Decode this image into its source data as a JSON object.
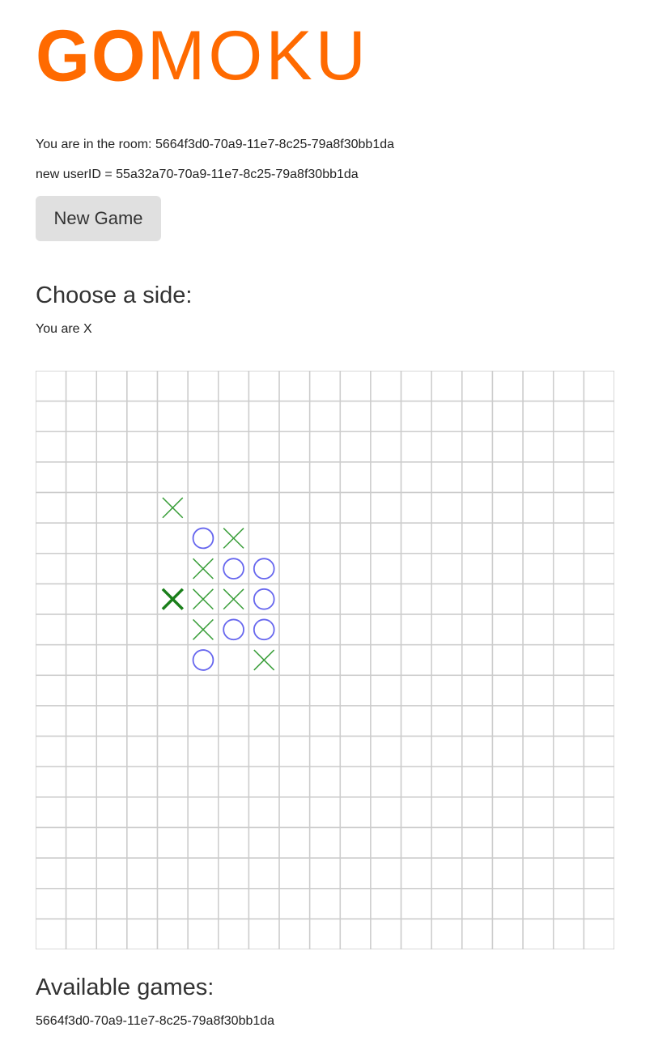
{
  "app": {
    "logo_bold": "GO",
    "logo_thin": "MOKU"
  },
  "room": {
    "label": "You are in the room: 5664f3d0-70a9-11e7-8c25-79a8f30bb1da"
  },
  "user": {
    "label": "new userID = 55a32a70-70a9-11e7-8c25-79a8f30bb1da"
  },
  "controls": {
    "new_game_label": "New Game"
  },
  "side": {
    "heading": "Choose a side:",
    "status": "You are X"
  },
  "board": {
    "rows": 19,
    "cols": 19,
    "grid_color": "#cccccc",
    "x_color": "#3a9e3a",
    "x_last_color": "#1a7f1a",
    "o_color": "#6666ee",
    "pieces": [
      {
        "row": 4,
        "col": 4,
        "mark": "X"
      },
      {
        "row": 5,
        "col": 5,
        "mark": "O"
      },
      {
        "row": 5,
        "col": 6,
        "mark": "X"
      },
      {
        "row": 6,
        "col": 5,
        "mark": "X"
      },
      {
        "row": 6,
        "col": 6,
        "mark": "O"
      },
      {
        "row": 6,
        "col": 7,
        "mark": "O"
      },
      {
        "row": 7,
        "col": 4,
        "mark": "X",
        "last": true
      },
      {
        "row": 7,
        "col": 5,
        "mark": "X"
      },
      {
        "row": 7,
        "col": 6,
        "mark": "X"
      },
      {
        "row": 7,
        "col": 7,
        "mark": "O"
      },
      {
        "row": 8,
        "col": 5,
        "mark": "X"
      },
      {
        "row": 8,
        "col": 6,
        "mark": "O"
      },
      {
        "row": 8,
        "col": 7,
        "mark": "O"
      },
      {
        "row": 9,
        "col": 5,
        "mark": "O"
      },
      {
        "row": 9,
        "col": 7,
        "mark": "X"
      }
    ]
  },
  "games": {
    "heading": "Available games:",
    "items": [
      "5664f3d0-70a9-11e7-8c25-79a8f30bb1da"
    ]
  },
  "colors": {
    "brand": "#ff6a00",
    "button_bg": "#e0e0e0"
  }
}
